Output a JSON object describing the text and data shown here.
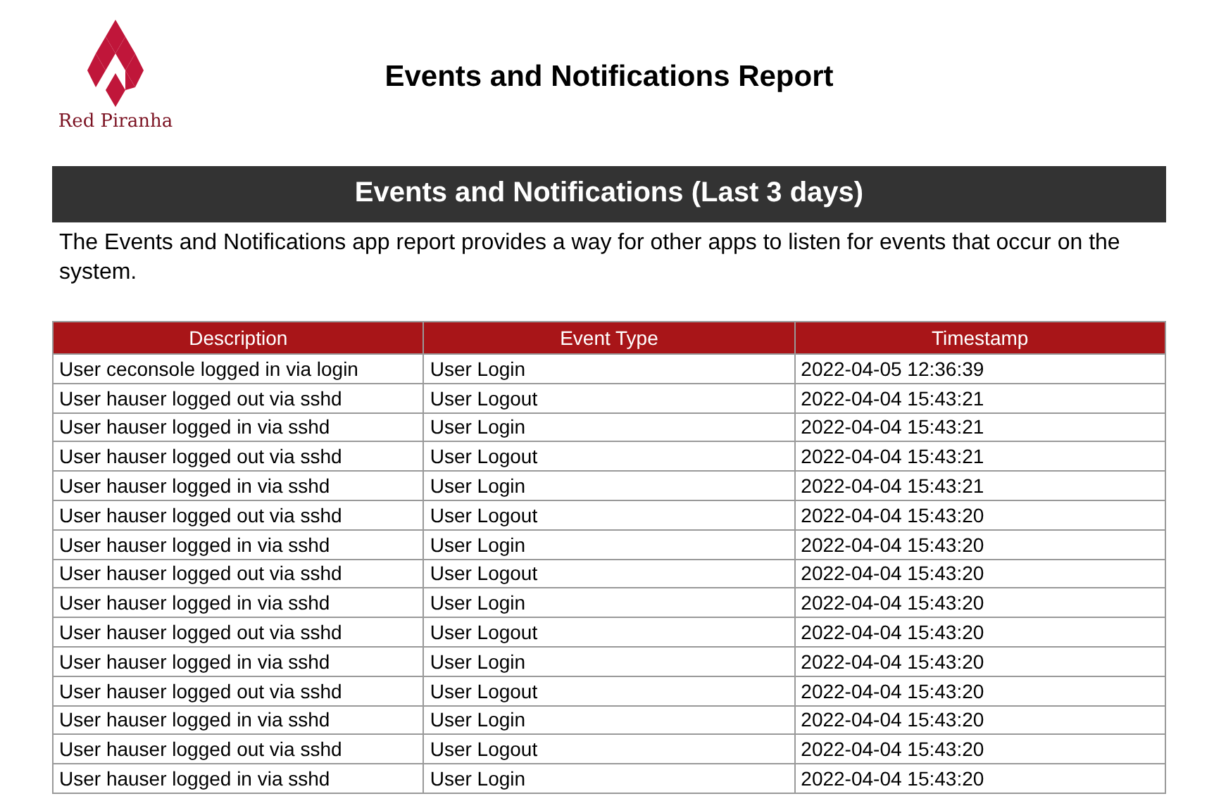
{
  "logo": {
    "text": "Red Piranha"
  },
  "report_title": "Events and Notifications Report",
  "section": {
    "title": "Events and Notifications (Last 3 days)",
    "description": "The Events and Notifications app report provides a way for other apps to listen for events that occur on the system."
  },
  "table": {
    "columns": [
      "Description",
      "Event Type",
      "Timestamp"
    ],
    "rows": [
      [
        "User ceconsole logged in via login",
        "User Login",
        "2022-04-05 12:36:39"
      ],
      [
        "User hauser logged out via sshd",
        "User Logout",
        "2022-04-04 15:43:21"
      ],
      [
        "User hauser logged in via sshd",
        "User Login",
        "2022-04-04 15:43:21"
      ],
      [
        "User hauser logged out via sshd",
        "User Logout",
        "2022-04-04 15:43:21"
      ],
      [
        "User hauser logged in via sshd",
        "User Login",
        "2022-04-04 15:43:21"
      ],
      [
        "User hauser logged out via sshd",
        "User Logout",
        "2022-04-04 15:43:20"
      ],
      [
        "User hauser logged in via sshd",
        "User Login",
        "2022-04-04 15:43:20"
      ],
      [
        "User hauser logged out via sshd",
        "User Logout",
        "2022-04-04 15:43:20"
      ],
      [
        "User hauser logged in via sshd",
        "User Login",
        "2022-04-04 15:43:20"
      ],
      [
        "User hauser logged out via sshd",
        "User Logout",
        "2022-04-04 15:43:20"
      ],
      [
        "User hauser logged in via sshd",
        "User Login",
        "2022-04-04 15:43:20"
      ],
      [
        "User hauser logged out via sshd",
        "User Logout",
        "2022-04-04 15:43:20"
      ],
      [
        "User hauser logged in via sshd",
        "User Login",
        "2022-04-04 15:43:20"
      ],
      [
        "User hauser logged out via sshd",
        "User Logout",
        "2022-04-04 15:43:20"
      ],
      [
        "User hauser logged in via sshd",
        "User Login",
        "2022-04-04 15:43:20"
      ]
    ]
  }
}
